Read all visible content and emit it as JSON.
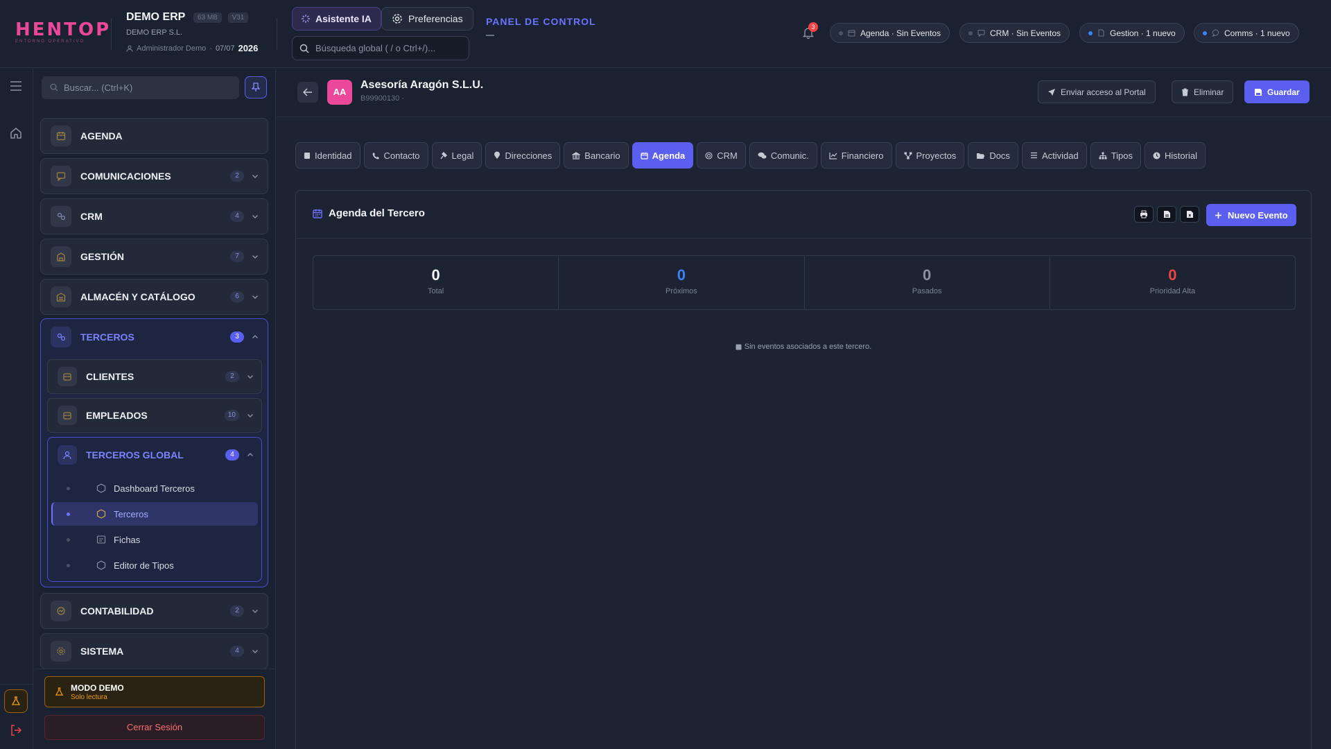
{
  "header": {
    "logo_text": "HENTOP",
    "logo_sub": "ENTORNO OPERATIVO",
    "app_name": "DEMO ERP",
    "size_badge": "63 MB",
    "version_badge": "V31",
    "company": "DEMO ERP S.L.",
    "user": "Administrador Demo",
    "date": "07/07",
    "year": "2026",
    "ai_button": "Asistente IA",
    "prefs_button": "Preferencias",
    "search_placeholder": "Búsqueda global ( / o Ctrl+/)...",
    "panel_link": "PANEL DE CONTROL",
    "notifications_count": "3",
    "status_chips": [
      {
        "label": "Agenda · Sin Eventos",
        "dot_color": "#4b5563"
      },
      {
        "label": "CRM · Sin Eventos",
        "dot_color": "#4b5563"
      },
      {
        "label": "Gestion · 1 nuevo",
        "dot_color": "#3b82f6"
      },
      {
        "label": "Comms · 1 nuevo",
        "dot_color": "#3b82f6"
      }
    ]
  },
  "sidebar": {
    "search_placeholder": "Buscar... (Ctrl+K)",
    "items": [
      {
        "label": "AGENDA",
        "count": ""
      },
      {
        "label": "COMUNICACIONES",
        "count": "2"
      },
      {
        "label": "CRM",
        "count": "4"
      },
      {
        "label": "GESTIÓN",
        "count": "7"
      },
      {
        "label": "ALMACÉN Y CATÁLOGO",
        "count": "6"
      }
    ],
    "terceros": {
      "label": "TERCEROS",
      "count": "3",
      "children": [
        {
          "label": "CLIENTES",
          "count": "2"
        },
        {
          "label": "EMPLEADOS",
          "count": "10"
        }
      ],
      "global": {
        "label": "TERCEROS GLOBAL",
        "count": "4",
        "leaves": [
          "Dashboard Terceros",
          "Terceros",
          "Fichas",
          "Editor de Tipos"
        ]
      }
    },
    "bottom_items": [
      {
        "label": "CONTABILIDAD",
        "count": "2"
      },
      {
        "label": "SISTEMA",
        "count": "4"
      }
    ],
    "demo_title": "MODO DEMO",
    "demo_sub": "Solo lectura",
    "logout": "Cerrar Sesión"
  },
  "record": {
    "initials": "AA",
    "name": "Asesoría Aragón S.L.U.",
    "id": "B99900130 ·",
    "btn_portal": "Enviar acceso al Portal",
    "btn_delete": "Eliminar",
    "btn_save": "Guardar"
  },
  "tabs": [
    "Identidad",
    "Contacto",
    "Legal",
    "Direcciones",
    "Bancario",
    "Agenda",
    "CRM",
    "Comunic.",
    "Financiero",
    "Proyectos",
    "Docs",
    "Actividad",
    "Tipos",
    "Historial"
  ],
  "agenda": {
    "title": "Agenda del Tercero",
    "new_event": "Nuevo Evento",
    "stats": [
      {
        "value": "0",
        "label": "Total",
        "color": "#f3f4f6"
      },
      {
        "value": "0",
        "label": "Próximos",
        "color": "#3b82f6"
      },
      {
        "value": "0",
        "label": "Pasados",
        "color": "#8b93a3"
      },
      {
        "value": "0",
        "label": "Prioridad Alta",
        "color": "#ef4444"
      }
    ],
    "empty_message": "Sin eventos asociados a este tercero."
  },
  "colors": {
    "accent": "#5b5ff0",
    "brand": "#ec4899",
    "warning": "#f59e0b",
    "danger": "#ef4444"
  }
}
